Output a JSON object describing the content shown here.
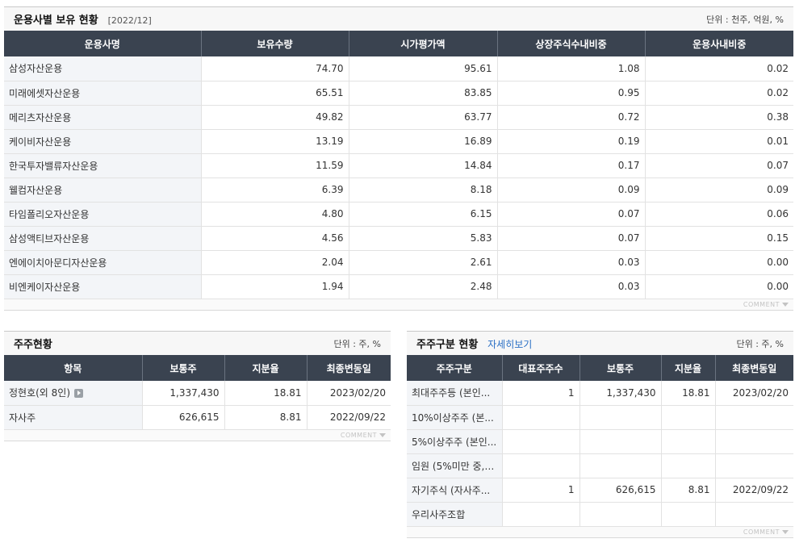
{
  "mgmt": {
    "title": "운용사별 보유 현황",
    "period": "[2022/12]",
    "unit": "단위 : 천주, 억원, %",
    "headers": [
      "운용사명",
      "보유수량",
      "시가평가액",
      "상장주식수내비중",
      "운용사내비중"
    ],
    "rows": [
      [
        "삼성자산운용",
        "74.70",
        "95.61",
        "1.08",
        "0.02"
      ],
      [
        "미래에셋자산운용",
        "65.51",
        "83.85",
        "0.95",
        "0.02"
      ],
      [
        "메리츠자산운용",
        "49.82",
        "63.77",
        "0.72",
        "0.38"
      ],
      [
        "케이비자산운용",
        "13.19",
        "16.89",
        "0.19",
        "0.01"
      ],
      [
        "한국투자밸류자산운용",
        "11.59",
        "14.84",
        "0.17",
        "0.07"
      ],
      [
        "웰컴자산운용",
        "6.39",
        "8.18",
        "0.09",
        "0.09"
      ],
      [
        "타임폴리오자산운용",
        "4.80",
        "6.15",
        "0.07",
        "0.06"
      ],
      [
        "삼성액티브자산운용",
        "4.56",
        "5.83",
        "0.07",
        "0.15"
      ],
      [
        "엔에이치아문디자산운용",
        "2.04",
        "2.61",
        "0.03",
        "0.00"
      ],
      [
        "비엔케이자산운용",
        "1.94",
        "2.48",
        "0.03",
        "0.00"
      ]
    ],
    "comment": "COMMENT"
  },
  "holders": {
    "title": "주주현황",
    "unit": "단위 : 주, %",
    "headers": [
      "항목",
      "보통주",
      "지분율",
      "최종변동일"
    ],
    "rows": [
      [
        "정현호(외 8인)",
        "1,337,430",
        "18.81",
        "2023/02/20"
      ],
      [
        "자사주",
        "626,615",
        "8.81",
        "2022/09/22"
      ]
    ],
    "comment": "COMMENT"
  },
  "types": {
    "title": "주주구분 현황",
    "link": "자세히보기",
    "unit": "단위 : 주, %",
    "headers": [
      "주주구분",
      "대표주주수",
      "보통주",
      "지분율",
      "최종변동일"
    ],
    "rows": [
      [
        "최대주주등 (본인...",
        "1",
        "1,337,430",
        "18.81",
        "2023/02/20"
      ],
      [
        "10%이상주주 (본...",
        "",
        "",
        "",
        ""
      ],
      [
        "5%이상주주 (본인...",
        "",
        "",
        "",
        ""
      ],
      [
        "임원 (5%미만 중, ...",
        "",
        "",
        "",
        ""
      ],
      [
        "자기주식 (자사주...",
        "1",
        "626,615",
        "8.81",
        "2022/09/22"
      ],
      [
        "우리사주조합",
        "",
        "",
        "",
        ""
      ]
    ],
    "comment": "COMMENT"
  }
}
